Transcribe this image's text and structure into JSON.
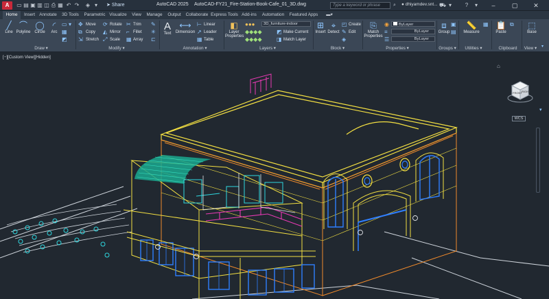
{
  "app": {
    "button": "A",
    "version": "AutoCAD 2025",
    "file": "AutoCAD-FY21_Fire-Station-Book-Cafe_01_3D.dwg"
  },
  "quick": {
    "share": "Share"
  },
  "search": {
    "placeholder": "Type a keyword or phrase"
  },
  "user": {
    "name": "dhiyamdev.snt..."
  },
  "tabs": [
    "Home",
    "Insert",
    "Annotate",
    "3D Tools",
    "Parametric",
    "Visualize",
    "View",
    "Manage",
    "Output",
    "Collaborate",
    "Express Tools",
    "Add-ins",
    "Automation",
    "Featured Apps"
  ],
  "panels": {
    "draw": {
      "name": "Draw",
      "line": "Line",
      "polyline": "Polyline",
      "circle": "Circle",
      "arc": "Arc"
    },
    "modify": {
      "name": "Modify",
      "move": "Move",
      "rotate": "Rotate",
      "trim": "Trim",
      "copy": "Copy",
      "mirror": "Mirror",
      "fillet": "Fillet",
      "stretch": "Stretch",
      "scale": "Scale",
      "array": "Array"
    },
    "annotation": {
      "name": "Annotation",
      "text": "Text",
      "dimension": "Dimension",
      "linear": "Linear",
      "leader": "Leader",
      "table": "Table"
    },
    "layers": {
      "name": "Layers",
      "props": "Layer Properties",
      "current": "3D_furniture-indoor",
      "make_current": "Make Current",
      "match_layer": "Match Layer"
    },
    "block": {
      "name": "Block",
      "insert": "Insert",
      "detect": "Detect",
      "create": "Create",
      "edit": "Edit"
    },
    "properties": {
      "name": "Properties",
      "match": "Match Properties",
      "color": "ByLayer",
      "linetype": "ByLayer",
      "lineweight": "ByLayer"
    },
    "groups": {
      "name": "Groups",
      "group": "Group"
    },
    "utilities": {
      "name": "Utilities",
      "measure": "Measure"
    },
    "clipboard": {
      "name": "Clipboard",
      "paste": "Paste"
    },
    "view": {
      "name": "View",
      "base": "Base"
    }
  },
  "viewport": {
    "label": "[−][Custom View][Hidden]",
    "cube_front": "FRONT",
    "cube_right": "RIGHT",
    "wcs": "WCS"
  },
  "colors": {
    "accent": "#c8293a",
    "yellow": "#f4e042",
    "cyan": "#2fd8e0",
    "magenta": "#ea3ab5",
    "blue": "#2f7fff",
    "green": "#21b8a0",
    "orange": "#f08a2b"
  }
}
